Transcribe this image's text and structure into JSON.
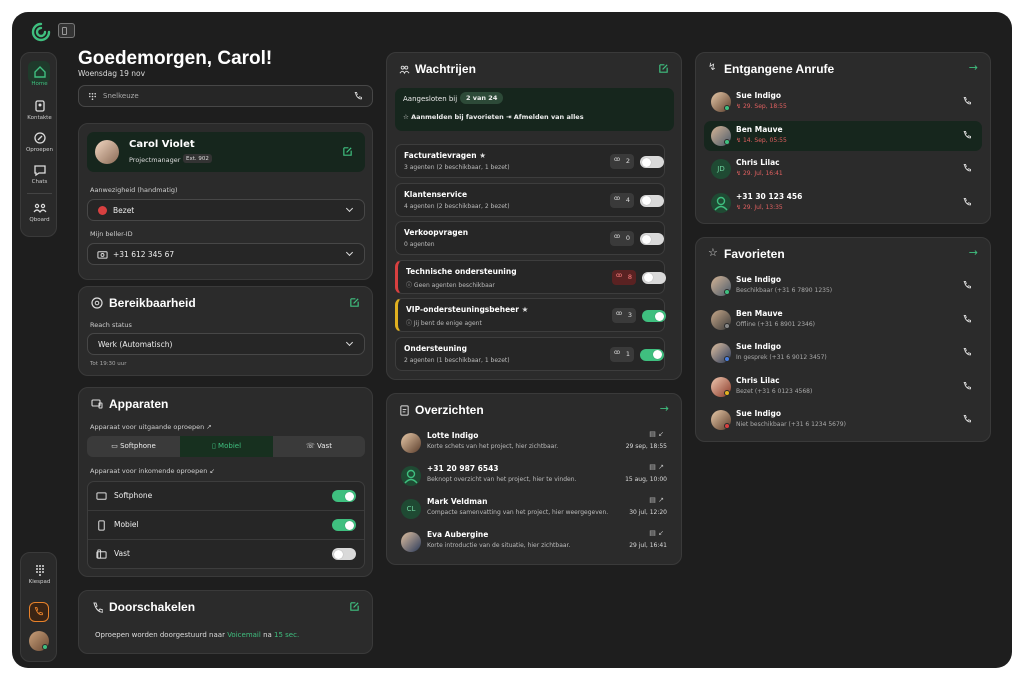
{
  "sidebar": {
    "items": [
      {
        "label": "Home",
        "icon": "home-icon"
      },
      {
        "label": "Kontakte",
        "icon": "contacts-icon"
      },
      {
        "label": "Oproepen",
        "icon": "calls-icon"
      },
      {
        "label": "Chats",
        "icon": "chats-icon"
      },
      {
        "label": "Qboard",
        "icon": "qboard-icon"
      }
    ],
    "bottom": {
      "keypad_label": "Kiespad"
    }
  },
  "header": {
    "greeting": "Goedemorgen, Carol!",
    "date": "Woensdag 19 nov"
  },
  "quickdial": {
    "placeholder": "Snelkeuze"
  },
  "profile": {
    "name": "Carol Violet",
    "role": "Projectmanager",
    "ext": "Ext. 902",
    "presence_label": "Aanwezigheid (handmatig)",
    "presence_value": "Bezet",
    "callerid_label": "Mijn beller-ID",
    "callerid_value": "+31 612 345 67"
  },
  "reach": {
    "title": "Bereikbaarheid",
    "status_label": "Reach status",
    "status_value": "Werk (Automatisch)",
    "until": "Tot 19:30 uur"
  },
  "devices": {
    "title": "Apparaten",
    "outgoing_label": "Apparaat voor uitgaande oproepen ↗",
    "tabs": [
      "Softphone",
      "Mobiel",
      "Vast"
    ],
    "incoming_label": "Apparaat voor inkomende oproepen ↙",
    "rows": [
      {
        "label": "Softphone",
        "on": true
      },
      {
        "label": "Mobiel",
        "on": true
      },
      {
        "label": "Vast",
        "on": false
      }
    ]
  },
  "forward": {
    "title": "Doorschakelen",
    "text_prefix": "Oproepen worden doorgestuurd naar",
    "target": "Voicemail",
    "text_mid": "na",
    "delay": "15 sec."
  },
  "queues": {
    "title": "Wachtrijen",
    "joined_label": "Aangesloten bij",
    "joined_value": "2 van 24",
    "fav_action": "Aanmelden bij favorieten",
    "all_action": "Afmelden van alles",
    "items": [
      {
        "name": "Facturatievragen",
        "star": "★",
        "sub": "3 agenten (2 beschikbaar, 1 bezet)",
        "count": "2",
        "on": false,
        "accent": ""
      },
      {
        "name": "Klantenservice",
        "star": "",
        "sub": "4 agenten (2 beschikbaar, 2 bezet)",
        "count": "4",
        "on": false,
        "accent": ""
      },
      {
        "name": "Verkoopvragen",
        "star": "",
        "sub": "0 agenten",
        "count": "0",
        "on": false,
        "accent": ""
      },
      {
        "name": "Technische ondersteuning",
        "star": "",
        "sub": "Geen agenten beschikbaar",
        "count": "8",
        "on": false,
        "accent": "#d84040"
      },
      {
        "name": "VIP-ondersteuningsbeheer",
        "star": "★",
        "sub": "Jij bent de enige agent",
        "count": "3",
        "on": true,
        "accent": "#e0b020"
      },
      {
        "name": "Ondersteuning",
        "star": "",
        "sub": "2 agenten (1 beschikbaar, 1 bezet)",
        "count": "1",
        "on": true,
        "accent": ""
      }
    ]
  },
  "overviews": {
    "title": "Overzichten",
    "items": [
      {
        "name": "Lotte Indigo",
        "desc": "Korte schets van het project, hier zichtbaar.",
        "date": "29 sep, 18:55",
        "dir": "↙"
      },
      {
        "name": "+31 20 987 6543",
        "desc": "Beknopt overzicht van het project, hier te vinden.",
        "date": "15 aug, 10:00",
        "dir": "↗"
      },
      {
        "name": "Mark Veldman",
        "desc": "Compacte samenvatting van het project, hier weergegeven.",
        "date": "30 jul, 12:20",
        "dir": "↗",
        "initials": "CL"
      },
      {
        "name": "Eva Aubergine",
        "desc": "Korte introductie van de situatie, hier zichtbaar.",
        "date": "29 jul, 16:41",
        "dir": "↙"
      }
    ]
  },
  "missed": {
    "title": "Entgangene Anrufe",
    "items": [
      {
        "name": "Sue Indigo",
        "info": "29. Sep, 18:55"
      },
      {
        "name": "Ben Mauve",
        "info": "14. Sep, 05:55"
      },
      {
        "name": "Chris Lilac",
        "info": "29. Jul, 16:41",
        "initials": "JD"
      },
      {
        "name": "+31 30 123 456",
        "info": "29. Jul, 13:35"
      }
    ]
  },
  "favorites": {
    "title": "Favorieten",
    "items": [
      {
        "name": "Sue Indigo",
        "info": "Beschikbaar (+31 6 7890 1235)",
        "status": "#3fbf7f"
      },
      {
        "name": "Ben Mauve",
        "info": "Offline (+31 6 8901 2346)",
        "status": "#888888"
      },
      {
        "name": "Sue Indigo",
        "info": "In gesprek (+31 6 9012 3457)",
        "status": "#4a7fe0"
      },
      {
        "name": "Chris Lilac",
        "info": "Bezet (+31 6 0123 4568)",
        "status": "#e0b020"
      },
      {
        "name": "Sue Indigo",
        "info": "Niet beschikbaar (+31 6 1234 5679)",
        "status": "#d84040"
      }
    ]
  },
  "colors": {
    "accent": "#3fbf7f",
    "busy": "#d84040",
    "background": "#1e1e1e",
    "card": "#2b2b2b"
  }
}
